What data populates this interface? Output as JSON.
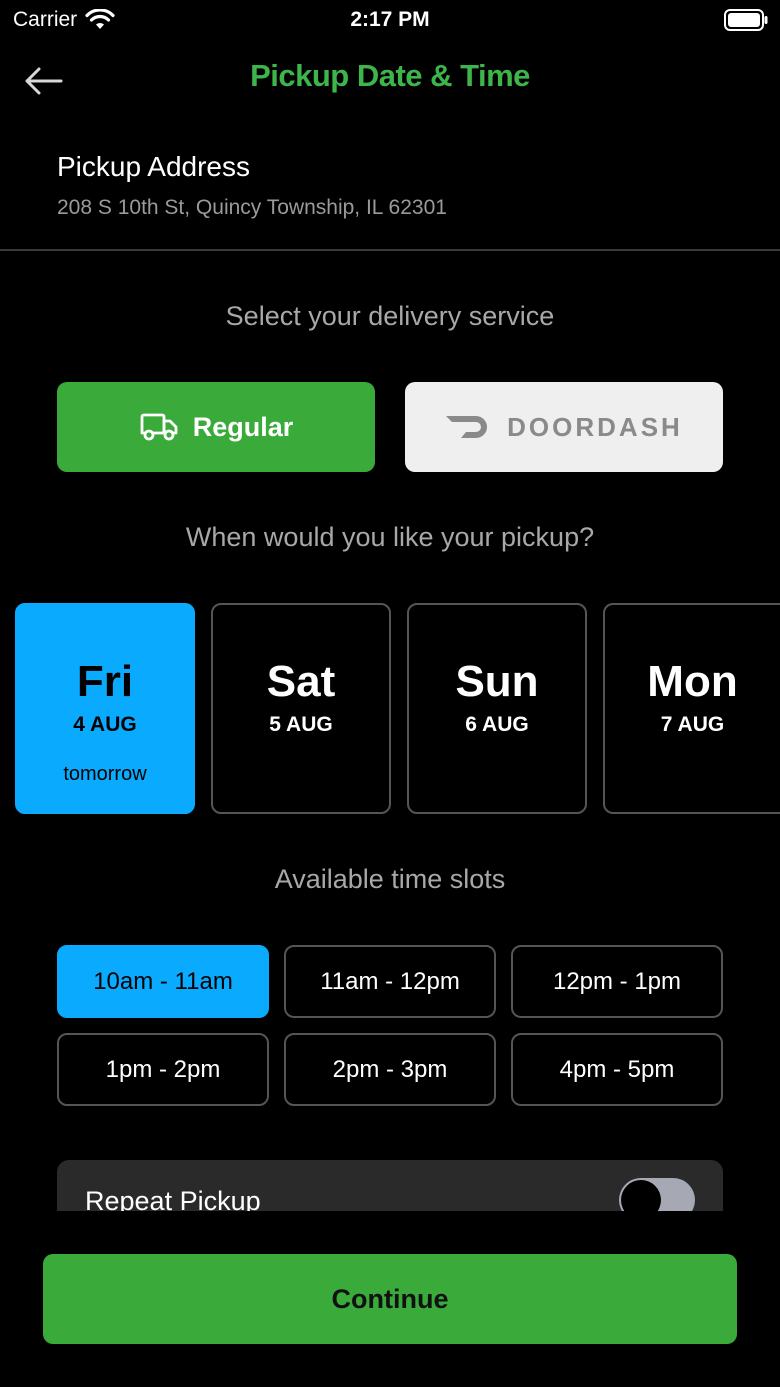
{
  "status_bar": {
    "carrier": "Carrier",
    "time": "2:17 PM"
  },
  "header": {
    "title": "Pickup Date & Time",
    "back_icon": "arrow-left-icon",
    "title_color": "#3db54a"
  },
  "address": {
    "label": "Pickup Address",
    "value": "208 S 10th St, Quincy Township, IL 62301"
  },
  "service": {
    "heading": "Select your delivery service",
    "options": [
      {
        "label": "Regular",
        "icon": "truck-icon",
        "selected": true
      },
      {
        "label": "DOORDASH",
        "icon": "doordash-logo-icon",
        "selected": false
      }
    ]
  },
  "dates": {
    "heading": "When would you like your pickup?",
    "items": [
      {
        "day": "Fri",
        "date": "4 AUG",
        "note": "tomorrow",
        "selected": true
      },
      {
        "day": "Sat",
        "date": "5 AUG",
        "note": "",
        "selected": false
      },
      {
        "day": "Sun",
        "date": "6 AUG",
        "note": "",
        "selected": false
      },
      {
        "day": "Mon",
        "date": "7 AUG",
        "note": "",
        "selected": false
      }
    ]
  },
  "slots": {
    "heading": "Available time slots",
    "items": [
      {
        "label": "10am - 11am",
        "selected": true
      },
      {
        "label": "11am - 12pm",
        "selected": false
      },
      {
        "label": "12pm - 1pm",
        "selected": false
      },
      {
        "label": "1pm - 2pm",
        "selected": false
      },
      {
        "label": "2pm - 3pm",
        "selected": false
      },
      {
        "label": "4pm - 5pm",
        "selected": false
      }
    ]
  },
  "repeat": {
    "label": "Repeat Pickup",
    "enabled": false
  },
  "continue_label": "Continue",
  "colors": {
    "accent_green": "#3aaa3a",
    "selected_blue": "#0aabff"
  }
}
